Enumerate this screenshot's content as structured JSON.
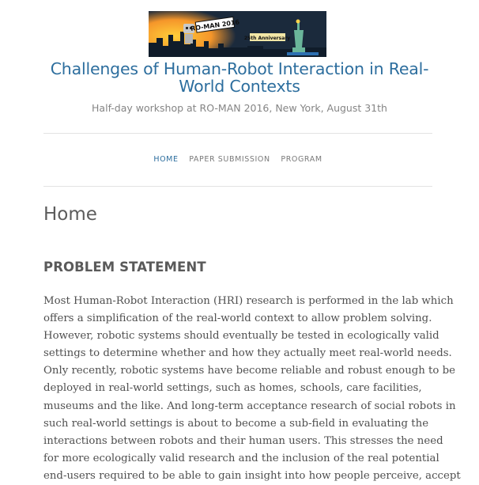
{
  "header": {
    "banner": {
      "text_left": "RO-MAN 2016",
      "text_right": "25th Anniversary"
    },
    "site_title": "Challenges of Human-Robot Interaction in Real-World Contexts",
    "site_description": "Half-day workshop at RO-MAN 2016, New York, August 31th"
  },
  "nav": {
    "items": [
      {
        "label": "HOME",
        "active": true
      },
      {
        "label": "PAPER SUBMISSION",
        "active": false
      },
      {
        "label": "PROGRAM",
        "active": false
      }
    ]
  },
  "main": {
    "page_title": "Home",
    "section_title": "PROBLEM STATEMENT",
    "paragraph_lines": [
      "Most Human-Robot Interaction (HRI) research is performed in the lab which",
      "offers a simplification of the real-world context to allow problem solving.",
      "However, robotic systems should eventually be tested in ecologically valid",
      "settings to determine whether and how they actually meet real-world needs.",
      "Only recently, robotic systems have become reliable and robust enough to be",
      "deployed in real-world settings, such as homes, schools, care facilities,",
      "museums and the like. And long-term acceptance research of social robots in",
      "such real-world settings is about to become a sub-field in evaluating the",
      "interactions between robots and their human users. This stresses the need",
      "for more ecologically valid research and the inclusion of the real potential",
      "end-users required to be able to gain insight into how people perceive, accept"
    ]
  },
  "colors": {
    "accent": "#2d6e9e",
    "heading": "#5c5c5c",
    "body_text": "#4f4f4f",
    "muted": "#858585",
    "rule": "#e2e2e2"
  }
}
